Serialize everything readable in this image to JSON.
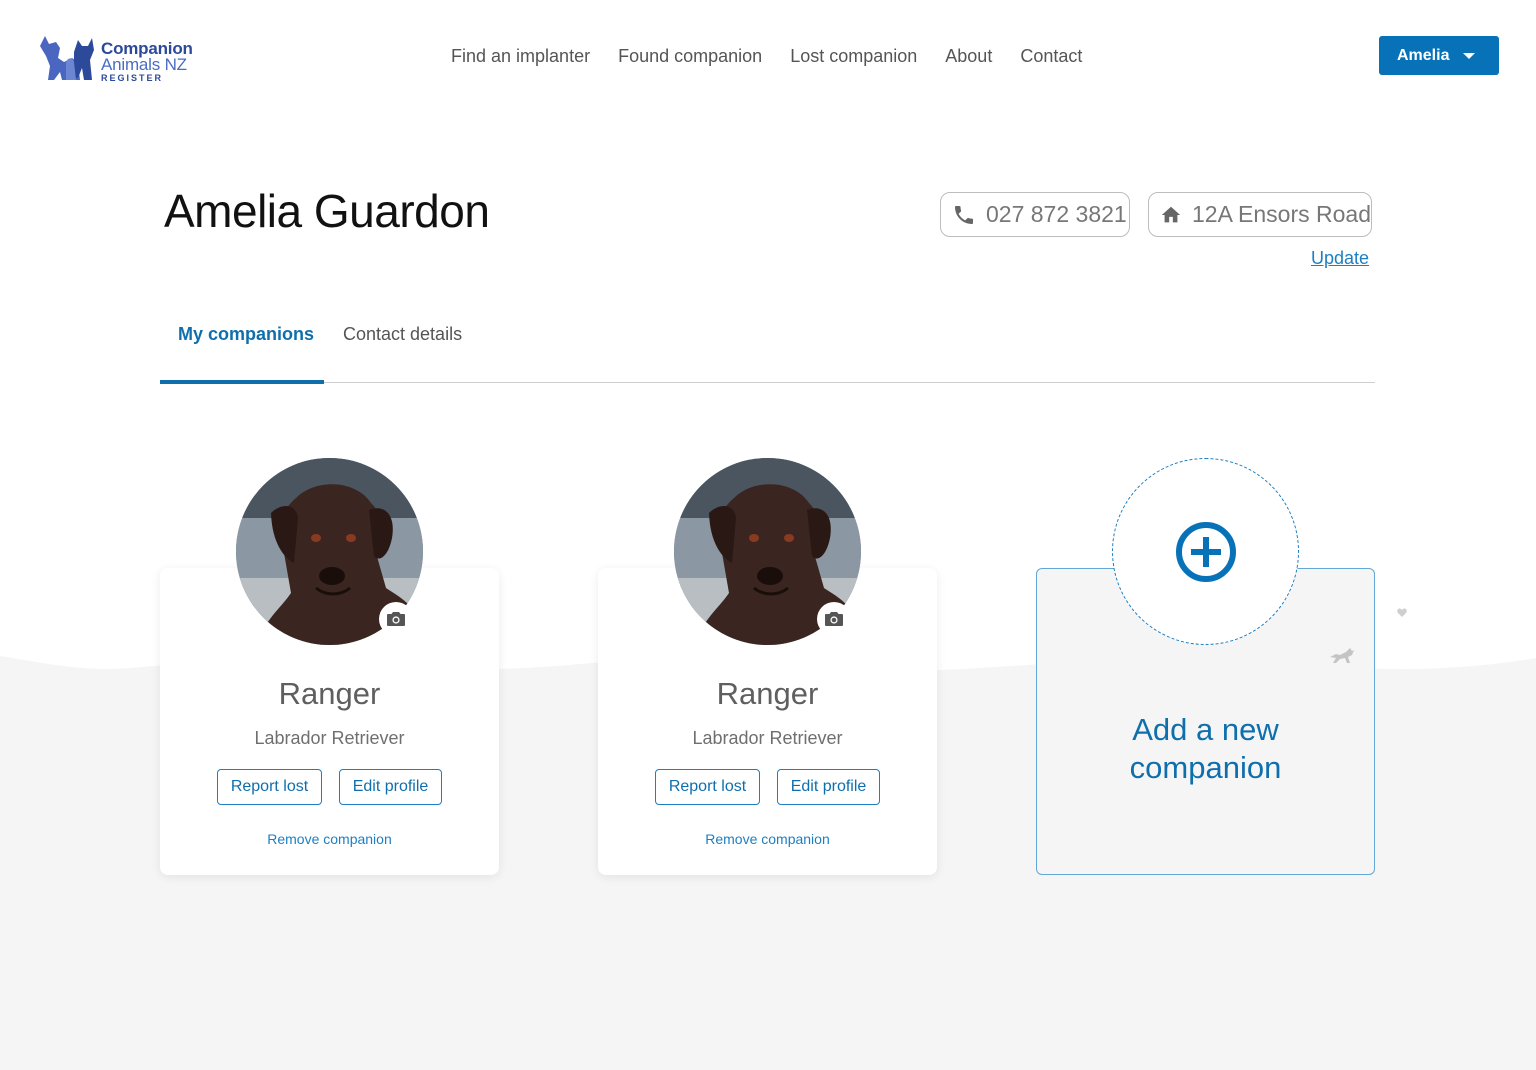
{
  "logo": {
    "line1": "Companion",
    "line2": "Animals NZ",
    "line3": "REGISTER"
  },
  "nav": {
    "items": [
      "Find an implanter",
      "Found companion",
      "Lost companion",
      "About",
      "Contact"
    ]
  },
  "user_menu": {
    "label": "Amelia"
  },
  "profile": {
    "name": "Amelia Guardon",
    "phone": "027 872 3821",
    "address": "12A Ensors Road",
    "update_label": "Update"
  },
  "tabs": [
    {
      "label": "My companions",
      "active": true
    },
    {
      "label": "Contact details",
      "active": false
    }
  ],
  "companions": [
    {
      "name": "Ranger",
      "breed": "Labrador Retriever",
      "report_lost_label": "Report lost",
      "edit_profile_label": "Edit profile",
      "remove_label": "Remove companion"
    },
    {
      "name": "Ranger",
      "breed": "Labrador Retriever",
      "report_lost_label": "Report lost",
      "edit_profile_label": "Edit profile",
      "remove_label": "Remove companion"
    }
  ],
  "add_companion": {
    "line1": "Add a new",
    "line2": "companion"
  },
  "colors": {
    "primary": "#0772b8",
    "link": "#1d7fc2",
    "background_grey": "#f5f5f5"
  }
}
